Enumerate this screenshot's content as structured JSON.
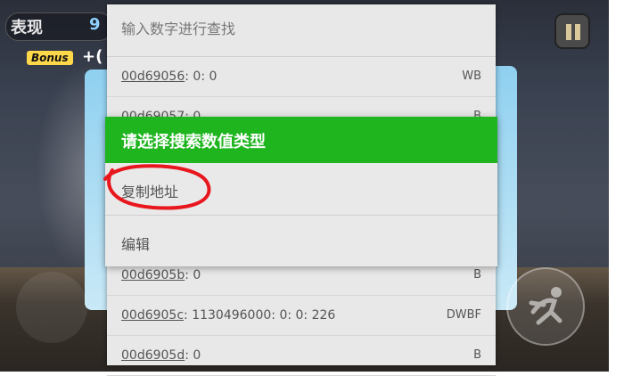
{
  "game": {
    "score_label": "表现",
    "score_value": "9",
    "bonus_label": "Bonus",
    "bonus_value": "+("
  },
  "panel": {
    "search_placeholder": "输入数字进行查找",
    "results": [
      {
        "address": "00d69056",
        "values": ": 0: 0",
        "type": "WB"
      },
      {
        "address": "00d69057",
        "values": ": 0",
        "type": "B"
      },
      {
        "address": "00d6905b",
        "values": ": 0",
        "type": "B"
      },
      {
        "address": "00d6905c",
        "values": ": 1130496000: 0: 0: 226",
        "type": "DWBF"
      },
      {
        "address": "00d6905d",
        "values": ": 0",
        "type": "B"
      }
    ]
  },
  "dialog": {
    "title": "请选择搜索数值类型",
    "options": [
      "复制地址",
      "编辑"
    ]
  },
  "colors": {
    "dialog_header": "#1fb51f",
    "annotation": "#e8171e"
  },
  "icons": [
    "pause-icon",
    "parkour-action-icon"
  ]
}
